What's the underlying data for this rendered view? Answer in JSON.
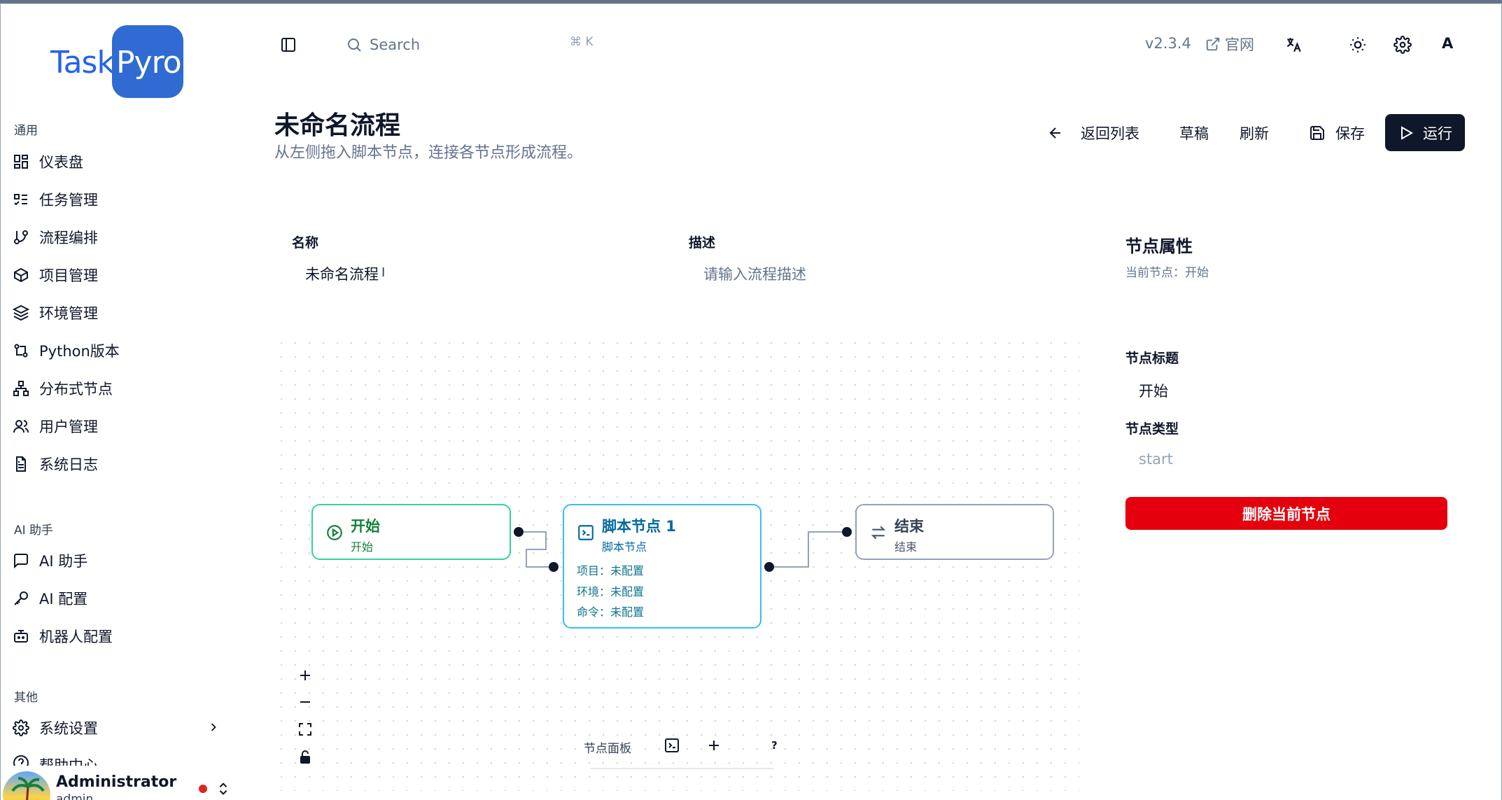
{
  "brand": {
    "task": "Task",
    "pyro": "Pyro"
  },
  "sidebar": {
    "groups": [
      {
        "label": "通用"
      },
      {
        "label": "AI 助手"
      },
      {
        "label": "其他"
      }
    ],
    "items": [
      {
        "label": "仪表盘",
        "icon": "dashboard-icon"
      },
      {
        "label": "任务管理",
        "icon": "list-todo-icon"
      },
      {
        "label": "流程编排",
        "icon": "git-branch-icon"
      },
      {
        "label": "项目管理",
        "icon": "package-icon"
      },
      {
        "label": "环境管理",
        "icon": "layers-icon"
      },
      {
        "label": "Python版本",
        "icon": "git-compare-icon"
      },
      {
        "label": "分布式节点",
        "icon": "network-icon"
      },
      {
        "label": "用户管理",
        "icon": "users-icon"
      },
      {
        "label": "系统日志",
        "icon": "file-text-icon"
      },
      {
        "label": "AI 助手",
        "icon": "message-square-icon"
      },
      {
        "label": "AI 配置",
        "icon": "key-icon"
      },
      {
        "label": "机器人配置",
        "icon": "bot-icon"
      },
      {
        "label": "系统设置",
        "icon": "gear-icon"
      },
      {
        "label": "帮助中心",
        "icon": "help-icon"
      }
    ],
    "user": {
      "name": "Administrator",
      "login": "admin"
    }
  },
  "header": {
    "search_placeholder": "Search",
    "shortcut": "⌘ K",
    "version": "v2.3.4",
    "site_link": "官网",
    "avatar_letter": "A"
  },
  "page": {
    "title": "未命名流程",
    "subtitle": "从左侧拖入脚本节点，连接各节点形成流程。",
    "actions": {
      "back": "返回列表",
      "draft": "草稿",
      "refresh": "刷新",
      "save": "保存",
      "run": "运行"
    }
  },
  "form": {
    "name_label": "名称",
    "name_value": "未命名流程",
    "desc_label": "描述",
    "desc_placeholder": "请输入流程描述"
  },
  "canvas": {
    "nodes": {
      "start": {
        "title": "开始",
        "sub": "开始"
      },
      "script": {
        "title": "脚本节点 1",
        "sub": "脚本节点",
        "project": "项目：未配置",
        "env": "环境：未配置",
        "command": "命令：未配置"
      },
      "end": {
        "title": "结束",
        "sub": "结束"
      }
    },
    "panel_label": "节点面板",
    "panel_help": "?"
  },
  "properties": {
    "title": "节点属性",
    "current": "当前节点：开始",
    "node_title_label": "节点标题",
    "node_title_value": "开始",
    "node_type_label": "节点类型",
    "node_type_value": "start",
    "delete_button": "删除当前节点"
  },
  "colors": {
    "brand_blue": "#2f6bd2",
    "start_green": "#15803d",
    "script_blue": "#0284c7",
    "end_slate": "#475569",
    "danger_red": "#e5000d",
    "primary_dark": "#0f172a"
  }
}
